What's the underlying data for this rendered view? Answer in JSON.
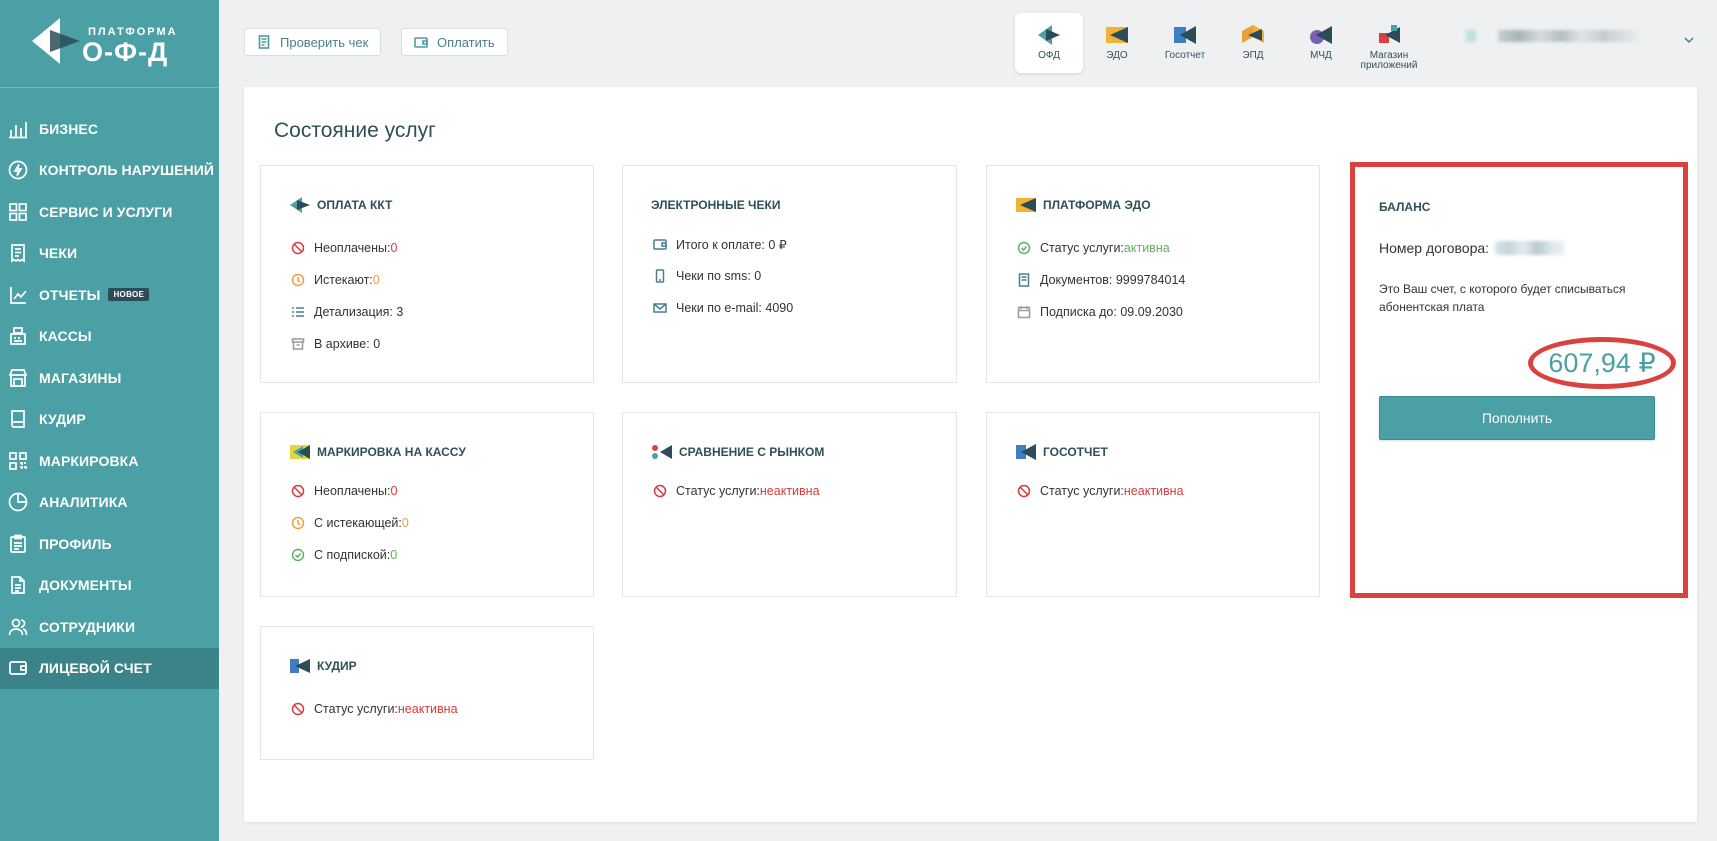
{
  "logo": {
    "top_text": "ПЛАТФОРМА",
    "main_text": "О-Ф-Д"
  },
  "sidebar": {
    "items": [
      {
        "label": "БИЗНЕС",
        "icon": "bar-chart-icon"
      },
      {
        "label": "КОНТРОЛЬ НАРУШЕНИЙ",
        "icon": "lightning-icon"
      },
      {
        "label": "СЕРВИС И УСЛУГИ",
        "icon": "grid-icon"
      },
      {
        "label": "ЧЕКИ",
        "icon": "receipt-icon"
      },
      {
        "label": "ОТЧЕТЫ",
        "icon": "report-icon",
        "badge": "НОВОЕ"
      },
      {
        "label": "КАССЫ",
        "icon": "cash-register-icon"
      },
      {
        "label": "МАГАЗИНЫ",
        "icon": "store-icon"
      },
      {
        "label": "КУДиР",
        "icon": "book-icon"
      },
      {
        "label": "МАРКИРОВКА",
        "icon": "qr-code-icon"
      },
      {
        "label": "АНАЛИТИКА",
        "icon": "pie-chart-icon"
      },
      {
        "label": "ПРОФИЛЬ",
        "icon": "clipboard-icon"
      },
      {
        "label": "ДОКУМЕНТЫ",
        "icon": "document-icon"
      },
      {
        "label": "СОТРУДНИКИ",
        "icon": "users-icon"
      },
      {
        "label": "ЛИЦЕВОЙ СЧЕТ",
        "icon": "wallet-icon",
        "active": true
      }
    ]
  },
  "toolbar": {
    "check_receipt": "Проверить чек",
    "pay": "Оплатить"
  },
  "apps": [
    {
      "label": "ОФД",
      "active": true
    },
    {
      "label": "ЭДО"
    },
    {
      "label": "Госотчет"
    },
    {
      "label": "ЭПД"
    },
    {
      "label": "МЧД"
    },
    {
      "label": "Магазин приложений"
    }
  ],
  "page": {
    "title": "Состояние услуг"
  },
  "cards": {
    "kkt": {
      "title": "ОПЛАТА ККТ",
      "unpaid_label": "Неоплачены: ",
      "unpaid_value": "0",
      "expiring_label": "Истекают: ",
      "expiring_value": "0",
      "details": "Детализация: 3",
      "archive": "В архиве: 0"
    },
    "echecks": {
      "title": "ЭЛЕКТРОННЫЕ ЧЕКИ",
      "total": "Итого к оплате: 0 ₽",
      "sms": "Чеки по sms: 0",
      "email": "Чеки по e-mail: 4090"
    },
    "edo": {
      "title": "ПЛАТФОРМА ЭДО",
      "status_label": "Статус услуги: ",
      "status_value": "активна",
      "documents": "Документов: 9999784014",
      "subscription": "Подписка до: 09.09.2030"
    },
    "marking": {
      "title": "МАРКИРОВКА НА КАССУ",
      "unpaid_label": "Неоплачены: ",
      "unpaid_value": "0",
      "expiring_label": "С истекающей: ",
      "expiring_value": "0",
      "subscribed_label": "С подпиской: ",
      "subscribed_value": "0"
    },
    "market": {
      "title": "СРАВНЕНИЕ С РЫНКОМ",
      "status_label": "Статус услуги: ",
      "status_value": "неактивна"
    },
    "gosotchet": {
      "title": "ГОСОТЧЕТ",
      "status_label": "Статус услуги: ",
      "status_value": "неактивна"
    },
    "kudir": {
      "title": "КУДИР",
      "status_label": "Статус услуги: ",
      "status_value": "неактивна"
    }
  },
  "balance": {
    "title": "БАЛАНС",
    "contract_label": "Номер договора:",
    "note": "Это Ваш счет, с которого будет списываться абонентская плата",
    "amount": "607,94 ₽",
    "topup": "Пополнить"
  },
  "colors": {
    "accent": "#4aa0a5",
    "sidebar_active": "#3a8489",
    "highlight": "#d9423f",
    "inactive": "#d93a3a",
    "active": "#5db35d",
    "warning": "#e9a13a"
  }
}
